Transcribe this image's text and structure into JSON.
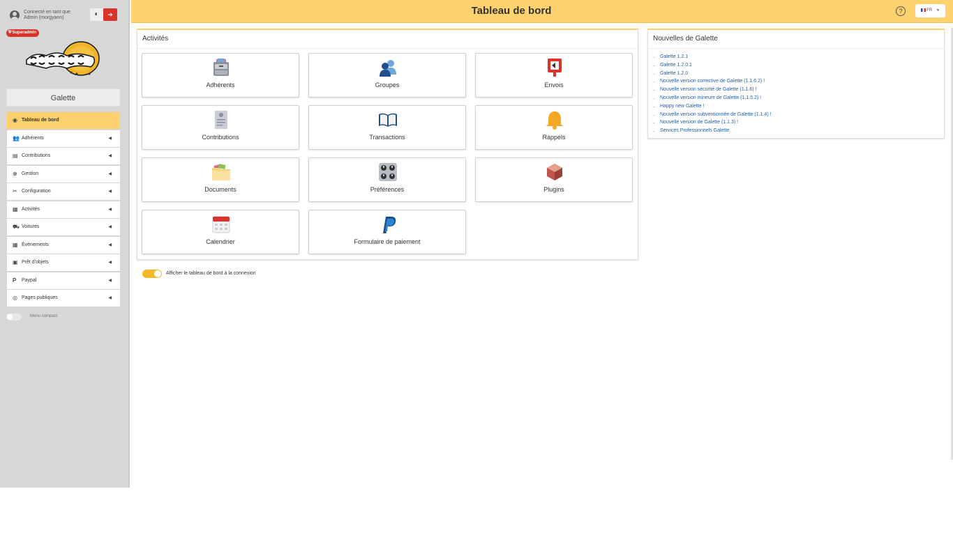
{
  "colors": {
    "accent": "#fdd26f",
    "danger": "#d9342b",
    "link": "#1f5fa8"
  },
  "sidebar": {
    "user_line1": "Connecté en tant que",
    "user_line2": "Admin (morgyann)",
    "badge": "Superadmin",
    "site_name": "Galette",
    "compact_menu": "Menu compact",
    "items": [
      {
        "label": "Tableau de bord",
        "icon": "dashboard-icon",
        "glyph": "◉"
      },
      {
        "label": "Adhérents",
        "icon": "users-icon",
        "glyph": "👥"
      },
      {
        "label": "Contributions",
        "icon": "receipt-icon",
        "glyph": "▤"
      },
      {
        "label": "Gestion",
        "icon": "globe-icon",
        "glyph": "⊕"
      },
      {
        "label": "Configuration",
        "icon": "tools-icon",
        "glyph": "✂"
      },
      {
        "label": "Activités",
        "icon": "calendar-icon",
        "glyph": "▦"
      },
      {
        "label": "Voitures",
        "icon": "car-icon",
        "glyph": "⛟"
      },
      {
        "label": "Évènements",
        "icon": "calendar-icon",
        "glyph": "▦"
      },
      {
        "label": "Prêt d'objets",
        "icon": "box-icon",
        "glyph": "▣"
      },
      {
        "label": "Paypal",
        "icon": "paypal-icon",
        "glyph": "P"
      },
      {
        "label": "Pages publiques",
        "icon": "eye-icon",
        "glyph": "◎"
      }
    ]
  },
  "header": {
    "title": "Tableau de bord",
    "help": "?",
    "lang": "FR"
  },
  "activities": {
    "title": "Activités",
    "tiles": [
      {
        "label": "Adhérents",
        "icon": "filing-cabinet-icon"
      },
      {
        "label": "Groupes",
        "icon": "group-users-icon"
      },
      {
        "label": "Envois",
        "icon": "mailbox-icon"
      },
      {
        "label": "Contributions",
        "icon": "receipt-document-icon"
      },
      {
        "label": "Transactions",
        "icon": "open-book-icon"
      },
      {
        "label": "Rappels",
        "icon": "bell-icon"
      },
      {
        "label": "Documents",
        "icon": "folder-icon"
      },
      {
        "label": "Préférences",
        "icon": "control-panel-icon"
      },
      {
        "label": "Plugins",
        "icon": "package-icon"
      },
      {
        "label": "Calendrier",
        "icon": "calendar-icon"
      },
      {
        "label": "Formulaire de paiement",
        "icon": "paypal-logo-icon"
      }
    ]
  },
  "news": {
    "title": "Nouvelles de Galette",
    "items": [
      "Galette 1.2.1",
      "Galette 1.2.0.1",
      "Galette 1.2.0",
      "Nouvelle version corrective de Galette (1.1.6.2) !",
      "Nouvelle version sécurité de Galette (1.1.6) !",
      "Nouvelle version mineure de Galette (1.1.5.2) !",
      "Happy new Galette !",
      "Nouvelle version subventionnée de Galette (1.1.4) !",
      "Nouvelle version de Galette (1.1.3) !",
      "Services Professionnels Galette"
    ]
  },
  "dashboard_toggle": {
    "label": "Afficher le tableau de bord à la connexion",
    "checked": true
  }
}
